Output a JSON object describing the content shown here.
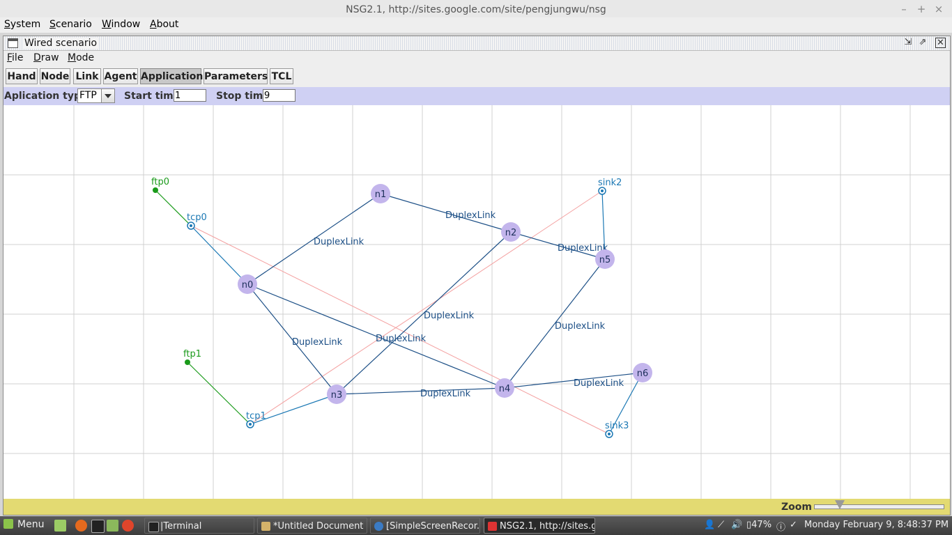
{
  "window": {
    "title": "NSG2.1, http://sites.google.com/site/pengjungwu/nsg"
  },
  "menu": {
    "items": [
      "System",
      "Scenario",
      "Window",
      "About"
    ]
  },
  "internal_frame": {
    "title": "Wired scenario",
    "menu": [
      "File",
      "Draw",
      "Mode"
    ],
    "toolbar": [
      "Hand",
      "Node",
      "Link",
      "Agent",
      "Application",
      "Parameters",
      "TCL"
    ],
    "active_tool": "Application"
  },
  "app_bar": {
    "type_label": "Aplication type",
    "type_value": "FTP",
    "start_label": "Start time",
    "start_value": "1",
    "stop_label": "Stop time",
    "stop_value": "9"
  },
  "scenario": {
    "node_color": "#c3b5ec",
    "link_color": "#1c4f86",
    "agent_color": "#1b78b4",
    "app_color": "#1a9a1a",
    "flow_color": "#f4a0a0",
    "nodes": [
      "n0",
      "n1",
      "n2",
      "n3",
      "n4",
      "n5",
      "n6"
    ],
    "link_label": "DuplexLink",
    "agents": [
      "tcp0",
      "tcp1",
      "sink2",
      "sink3"
    ],
    "apps": [
      "ftp0",
      "ftp1"
    ]
  },
  "zoom": {
    "label": "Zoom",
    "level": 0.2
  },
  "taskbar": {
    "menu_label": "Menu",
    "tasks": [
      "|Terminal",
      "*Untitled Document ...",
      "[SimpleScreenRecor...",
      "NSG2.1, http://sites.g..."
    ],
    "battery": "47%",
    "clock": "Monday February  9,  8:48:37 PM"
  }
}
